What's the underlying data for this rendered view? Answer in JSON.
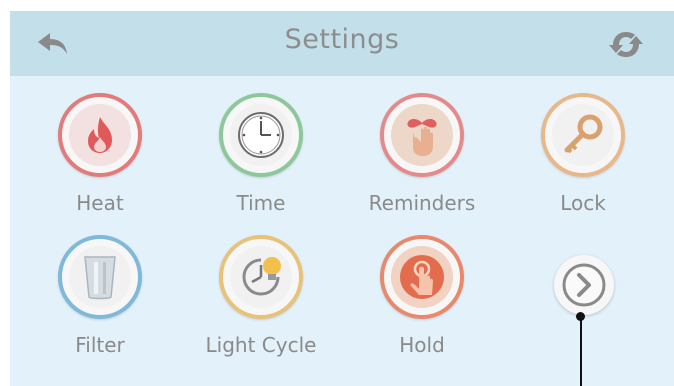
{
  "header": {
    "title": "Settings",
    "back_icon": "back-arrow-icon",
    "refresh_icon": "refresh-icon"
  },
  "items": [
    {
      "label": "Heat",
      "icon": "flame-icon",
      "ring": "#e47a7a"
    },
    {
      "label": "Time",
      "icon": "clock-icon",
      "ring": "#8dc89a"
    },
    {
      "label": "Reminders",
      "icon": "reminder-hand-icon",
      "ring": "#e58a8a"
    },
    {
      "label": "Lock",
      "icon": "key-icon",
      "ring": "#e8b88a"
    },
    {
      "label": "Filter",
      "icon": "filter-cup-icon",
      "ring": "#7fb9da"
    },
    {
      "label": "Light Cycle",
      "icon": "light-cycle-icon",
      "ring": "#e8c27a"
    },
    {
      "label": "Hold",
      "icon": "hold-hand-icon",
      "ring": "#e8896e"
    }
  ],
  "next": {
    "icon": "chevron-right-icon"
  }
}
